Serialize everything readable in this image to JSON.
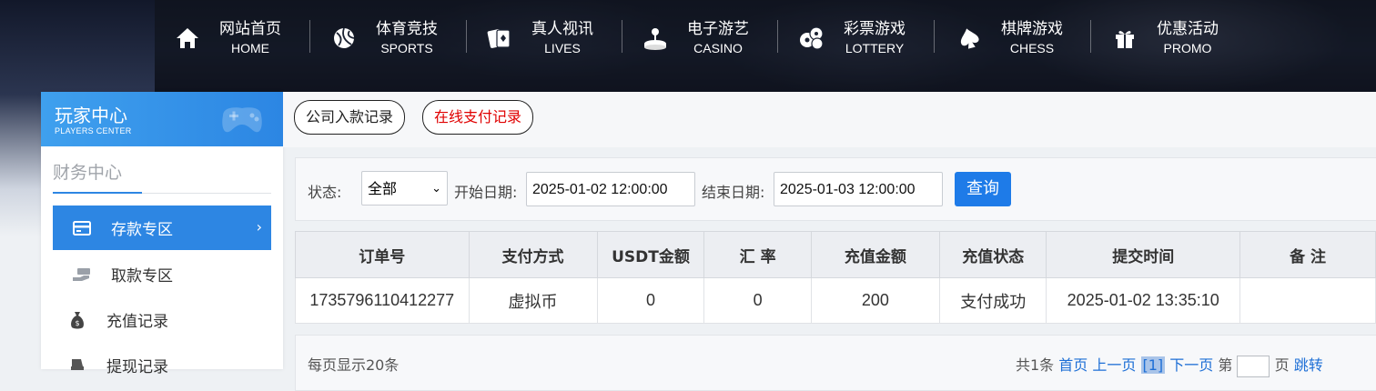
{
  "nav": {
    "items": [
      {
        "zh": "网站首页",
        "en": "HOME",
        "icon": "home-icon"
      },
      {
        "zh": "体育竞技",
        "en": "SPORTS",
        "icon": "ball-icon"
      },
      {
        "zh": "真人视讯",
        "en": "LIVES",
        "icon": "cards-icon"
      },
      {
        "zh": "电子游艺",
        "en": "CASINO",
        "icon": "joystick-icon"
      },
      {
        "zh": "彩票游戏",
        "en": "LOTTERY",
        "icon": "lottery-balls-icon"
      },
      {
        "zh": "棋牌游戏",
        "en": "CHESS",
        "icon": "spade-icon"
      },
      {
        "zh": "优惠活动",
        "en": "PROMO",
        "icon": "gift-icon"
      }
    ]
  },
  "sidebar": {
    "title": "玩家中心",
    "subtitle": "PLAYERS CENTER",
    "section": "财务中心",
    "items": [
      {
        "label": "存款专区",
        "icon": "wallet-icon",
        "active": true
      },
      {
        "label": "取款专区",
        "icon": "cash-hand-icon",
        "active": false
      },
      {
        "label": "充值记录",
        "icon": "money-bag-icon",
        "active": false
      },
      {
        "label": "提现记录",
        "icon": "withdraw-icon",
        "active": false
      }
    ]
  },
  "tabs": [
    "公司入款记录",
    "在线支付记录"
  ],
  "filter": {
    "status_label": "状态:",
    "status_value": "全部",
    "start_label": "开始日期:",
    "start_value": "2025-01-02 12:00:00",
    "end_label": "结束日期:",
    "end_value": "2025-01-03 12:00:00",
    "query_label": "查询"
  },
  "table": {
    "headers": [
      "订单号",
      "支付方式",
      "USDT金额",
      "汇 率",
      "充值金额",
      "充值状态",
      "提交时间",
      "备 注"
    ],
    "rows": [
      [
        "1735796110412277",
        "虚拟币",
        "0",
        "0",
        "200",
        "支付成功",
        "2025-01-02 13:35:10",
        ""
      ]
    ]
  },
  "pagination": {
    "per_page": "每页显示20条",
    "total": "共1条",
    "first": "首页",
    "prev": "上一页",
    "current": "[1]",
    "next": "下一页",
    "goto_prefix": "第",
    "goto_suffix": "页",
    "jump": "跳转"
  },
  "colors": {
    "accent": "#2d86e3",
    "tab_active_text": "#e00000",
    "button": "#1e7be8"
  }
}
